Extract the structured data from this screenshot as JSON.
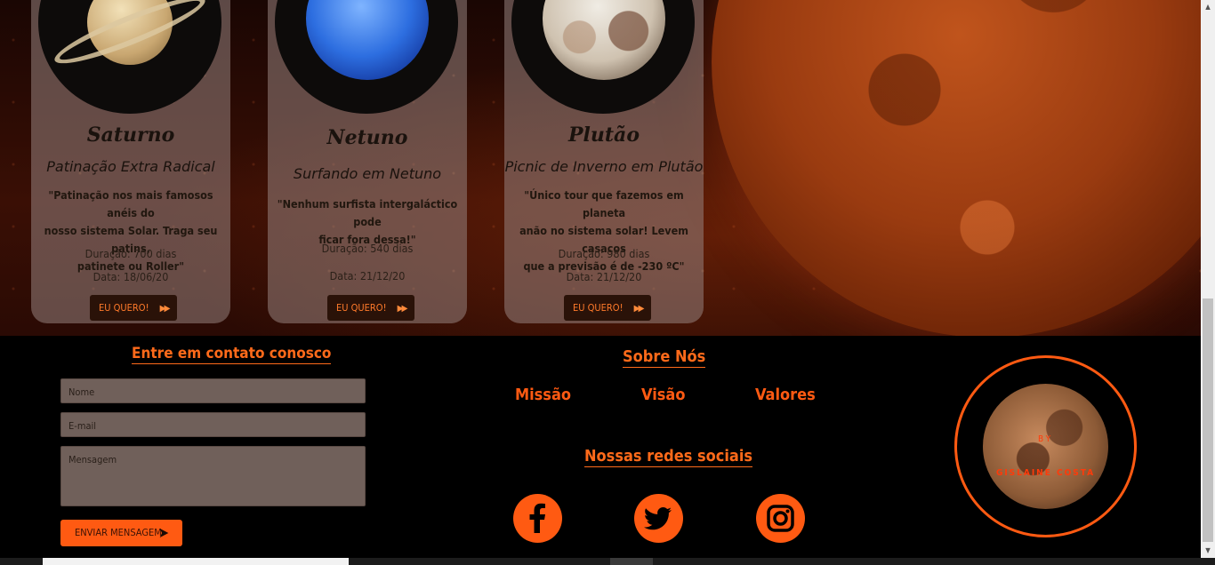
{
  "cards": [
    {
      "planet": "saturn-icon",
      "title": "Saturno",
      "subtitle": "Patinação Extra Radical",
      "description_lines": [
        "\"Patinação nos mais famosos anéis do",
        "nosso sistema Solar. Traga seu patins,",
        "patinete ou Roller\""
      ],
      "duration": "Duração: 700 dias",
      "date": "Data: 18/06/20",
      "button": "EU QUERO!"
    },
    {
      "planet": "neptune-icon",
      "title": "Netuno",
      "subtitle": "Surfando em Netuno",
      "description_lines": [
        "\"Nenhum surfista intergaláctico pode",
        "ficar fora dessa!\""
      ],
      "duration": "Duração: 540 dias",
      "date": "Data: 21/12/20",
      "button": "EU QUERO!"
    },
    {
      "planet": "pluto-icon",
      "title": "Plutão",
      "subtitle": "Picnic de Inverno em Plutão",
      "description_lines": [
        "\"Único tour que fazemos em planeta",
        "anão no sistema solar! Levem casacos",
        "que a previsão é de -230 ºC\""
      ],
      "duration": "Duração: 980 dias",
      "date": "Data: 21/12/20",
      "button": "EU QUERO!"
    }
  ],
  "contact": {
    "title": "Entre em contato conosco",
    "name_placeholder": "Nome",
    "email_placeholder": "E-mail",
    "message_placeholder": "Mensagem",
    "send_button": "ENVIAR MENSAGEM"
  },
  "about": {
    "title": "Sobre Nós",
    "links": [
      "Missão",
      "Visão",
      "Valores"
    ]
  },
  "social": {
    "title": "Nossas redes sociais",
    "icons": [
      "facebook-icon",
      "twitter-icon",
      "instagram-icon"
    ]
  },
  "badge": {
    "by": "BY",
    "name": "GISLAINE COSTA"
  },
  "colors": {
    "accent": "#ff5a12",
    "card_bg": "#968280",
    "footer_bg": "#000000"
  }
}
